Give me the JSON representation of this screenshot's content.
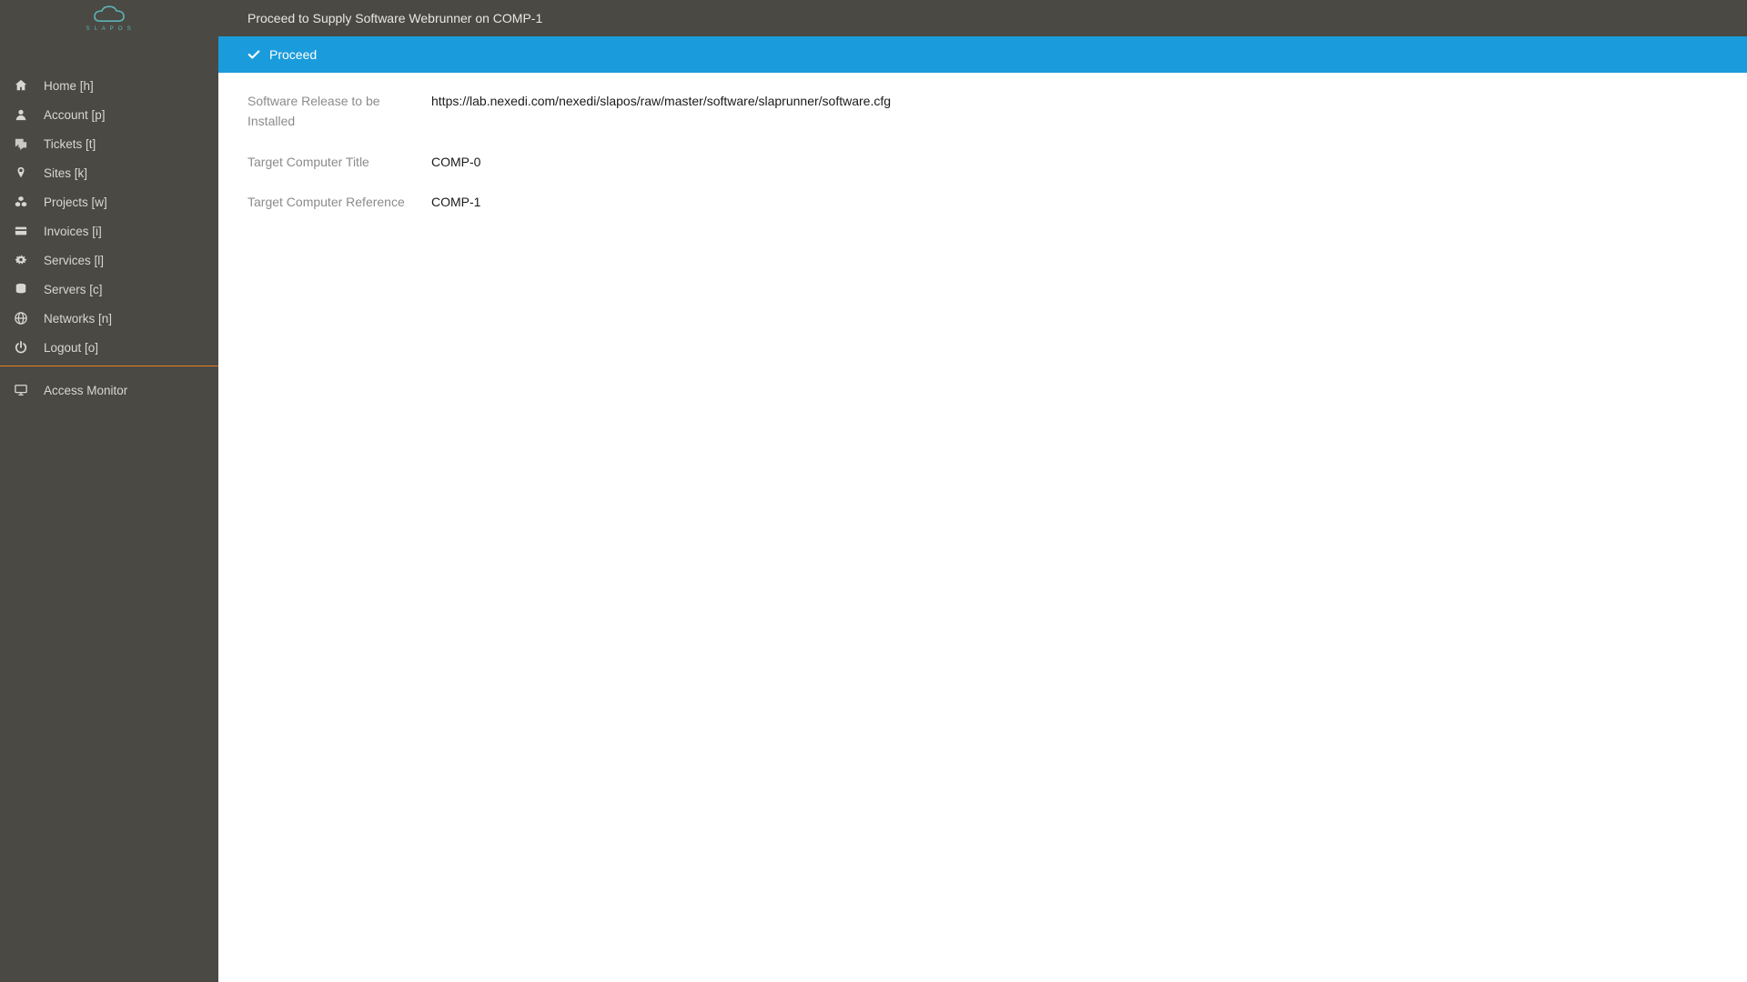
{
  "brand": {
    "name": "SLAPOS"
  },
  "sidebar": {
    "items": [
      {
        "label": "Home [h]",
        "icon": "home"
      },
      {
        "label": "Account [p]",
        "icon": "user"
      },
      {
        "label": "Tickets [t]",
        "icon": "chat"
      },
      {
        "label": "Sites [k]",
        "icon": "marker"
      },
      {
        "label": "Projects [w]",
        "icon": "cubes"
      },
      {
        "label": "Invoices [i]",
        "icon": "credit-card"
      },
      {
        "label": "Services [l]",
        "icon": "gears"
      },
      {
        "label": "Servers [c]",
        "icon": "database"
      },
      {
        "label": "Networks [n]",
        "icon": "globe"
      },
      {
        "label": "Logout [o]",
        "icon": "power"
      }
    ],
    "footer": {
      "label": "Access Monitor",
      "icon": "monitor"
    }
  },
  "header": {
    "title": "Proceed to Supply Software Webrunner on COMP-1"
  },
  "actions": {
    "proceed_label": "Proceed"
  },
  "fields": {
    "software_release": {
      "label": "Software Release to be Installed",
      "value": "https://lab.nexedi.com/nexedi/slapos/raw/master/software/slaprunner/software.cfg"
    },
    "target_computer_title": {
      "label": "Target Computer Title",
      "value": "COMP-0"
    },
    "target_computer_reference": {
      "label": "Target Computer Reference",
      "value": "COMP-1"
    }
  }
}
